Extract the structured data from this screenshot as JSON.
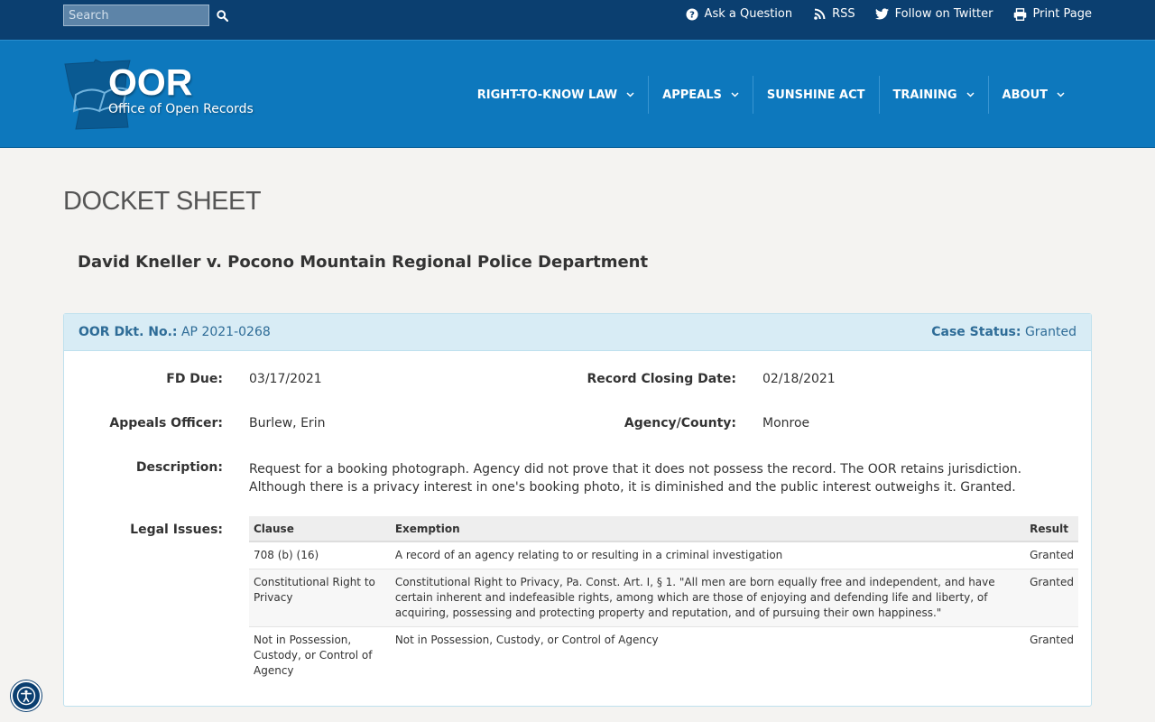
{
  "search": {
    "placeholder": "Search"
  },
  "utility_links": [
    {
      "label": "Ask a Question",
      "icon": "question-circle-icon"
    },
    {
      "label": "RSS",
      "icon": "rss-icon"
    },
    {
      "label": "Follow on Twitter",
      "icon": "twitter-icon"
    },
    {
      "label": "Print Page",
      "icon": "print-icon"
    }
  ],
  "logo": {
    "title": "OOR",
    "subtitle": "Office of Open Records"
  },
  "nav": [
    {
      "label": "RIGHT-TO-KNOW LAW",
      "has_dropdown": true
    },
    {
      "label": "APPEALS",
      "has_dropdown": true
    },
    {
      "label": "SUNSHINE ACT",
      "has_dropdown": false
    },
    {
      "label": "TRAINING",
      "has_dropdown": true
    },
    {
      "label": "ABOUT",
      "has_dropdown": true
    }
  ],
  "page_title": "DOCKET SHEET",
  "case_title": "David Kneller v. Pocono Mountain Regional Police Department",
  "panel": {
    "docket_label": "OOR Dkt. No.:",
    "docket_value": "AP 2021-0268",
    "status_label": "Case Status:",
    "status_value": "Granted"
  },
  "fields": {
    "fd_due_label": "FD Due:",
    "fd_due_value": "03/17/2021",
    "record_closing_label": "Record Closing Date:",
    "record_closing_value": "02/18/2021",
    "appeals_officer_label": "Appeals Officer:",
    "appeals_officer_value": "Burlew, Erin",
    "agency_county_label": "Agency/County:",
    "agency_county_value": "Monroe",
    "description_label": "Description:",
    "description_value": "Request for a booking photograph. Agency did not prove that it does not possess the record. The OOR retains jurisdiction. Although there is a privacy interest in one's booking photo, it is diminished and the public interest outweighs it. Granted.",
    "legal_issues_label": "Legal Issues:"
  },
  "legal_issues": {
    "headers": [
      "Clause",
      "Exemption",
      "Result"
    ],
    "rows": [
      [
        "708 (b) (16)",
        "A record of an agency relating to or resulting in a criminal investigation",
        "Granted"
      ],
      [
        "Constitutional Right to Privacy",
        "Constitutional Right to Privacy, Pa. Const. Art. I, § 1. \"All men are born equally free and independent, and have certain inherent and indefeasible rights, among which are those of enjoying and defending life and liberty, of acquiring, possessing and protecting property and reputation, and of pursuing their own happiness.\"",
        "Granted"
      ],
      [
        "Not in Possession, Custody, or Control of Agency",
        "Not in Possession, Custody, or Control of Agency",
        "Granted"
      ]
    ]
  },
  "colors": {
    "utility_bar": "#0b3f70",
    "header": "#0d78bd",
    "panel_head": "#d8ecf5",
    "link_text": "#2e6c97"
  }
}
